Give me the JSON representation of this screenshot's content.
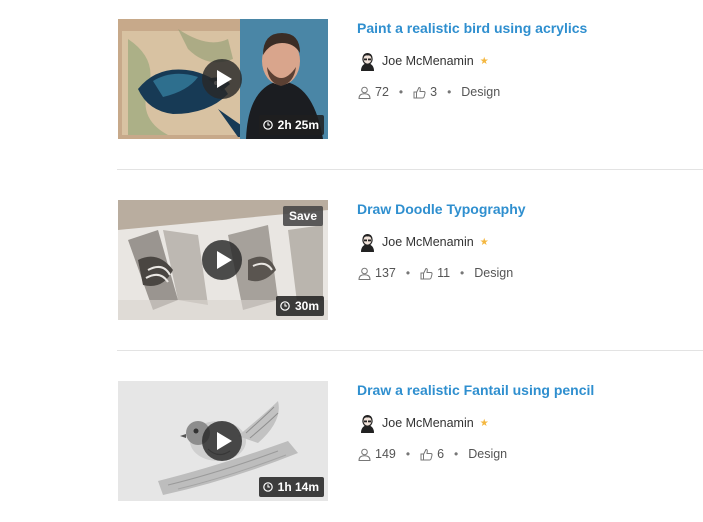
{
  "classes": [
    {
      "title": "Paint a realistic bird using acrylics",
      "author": "Joe McMenamin",
      "students": "72",
      "likes": "3",
      "category": "Design",
      "duration": "2h 25m",
      "save_label": "",
      "thumbnail": "tui-painting-thumbnail"
    },
    {
      "title": "Draw Doodle Typography",
      "author": "Joe McMenamin",
      "students": "137",
      "likes": "11",
      "category": "Design",
      "duration": "30m",
      "save_label": "Save",
      "thumbnail": "doodle-typography-thumbnail"
    },
    {
      "title": "Draw a realistic Fantail using pencil",
      "author": "Joe McMenamin",
      "students": "149",
      "likes": "6",
      "category": "Design",
      "duration": "1h 14m",
      "save_label": "",
      "thumbnail": "fantail-pencil-thumbnail"
    }
  ],
  "colors": {
    "title_link": "#2f8fcf",
    "star": "#f4b73f",
    "divider": "#e3e3e3",
    "badge_bg": "#1e1e1e"
  },
  "icons": {
    "students": "user-icon",
    "likes": "thumbs-up-icon",
    "duration": "clock-icon",
    "play": "play-icon",
    "featured": "star-icon"
  }
}
